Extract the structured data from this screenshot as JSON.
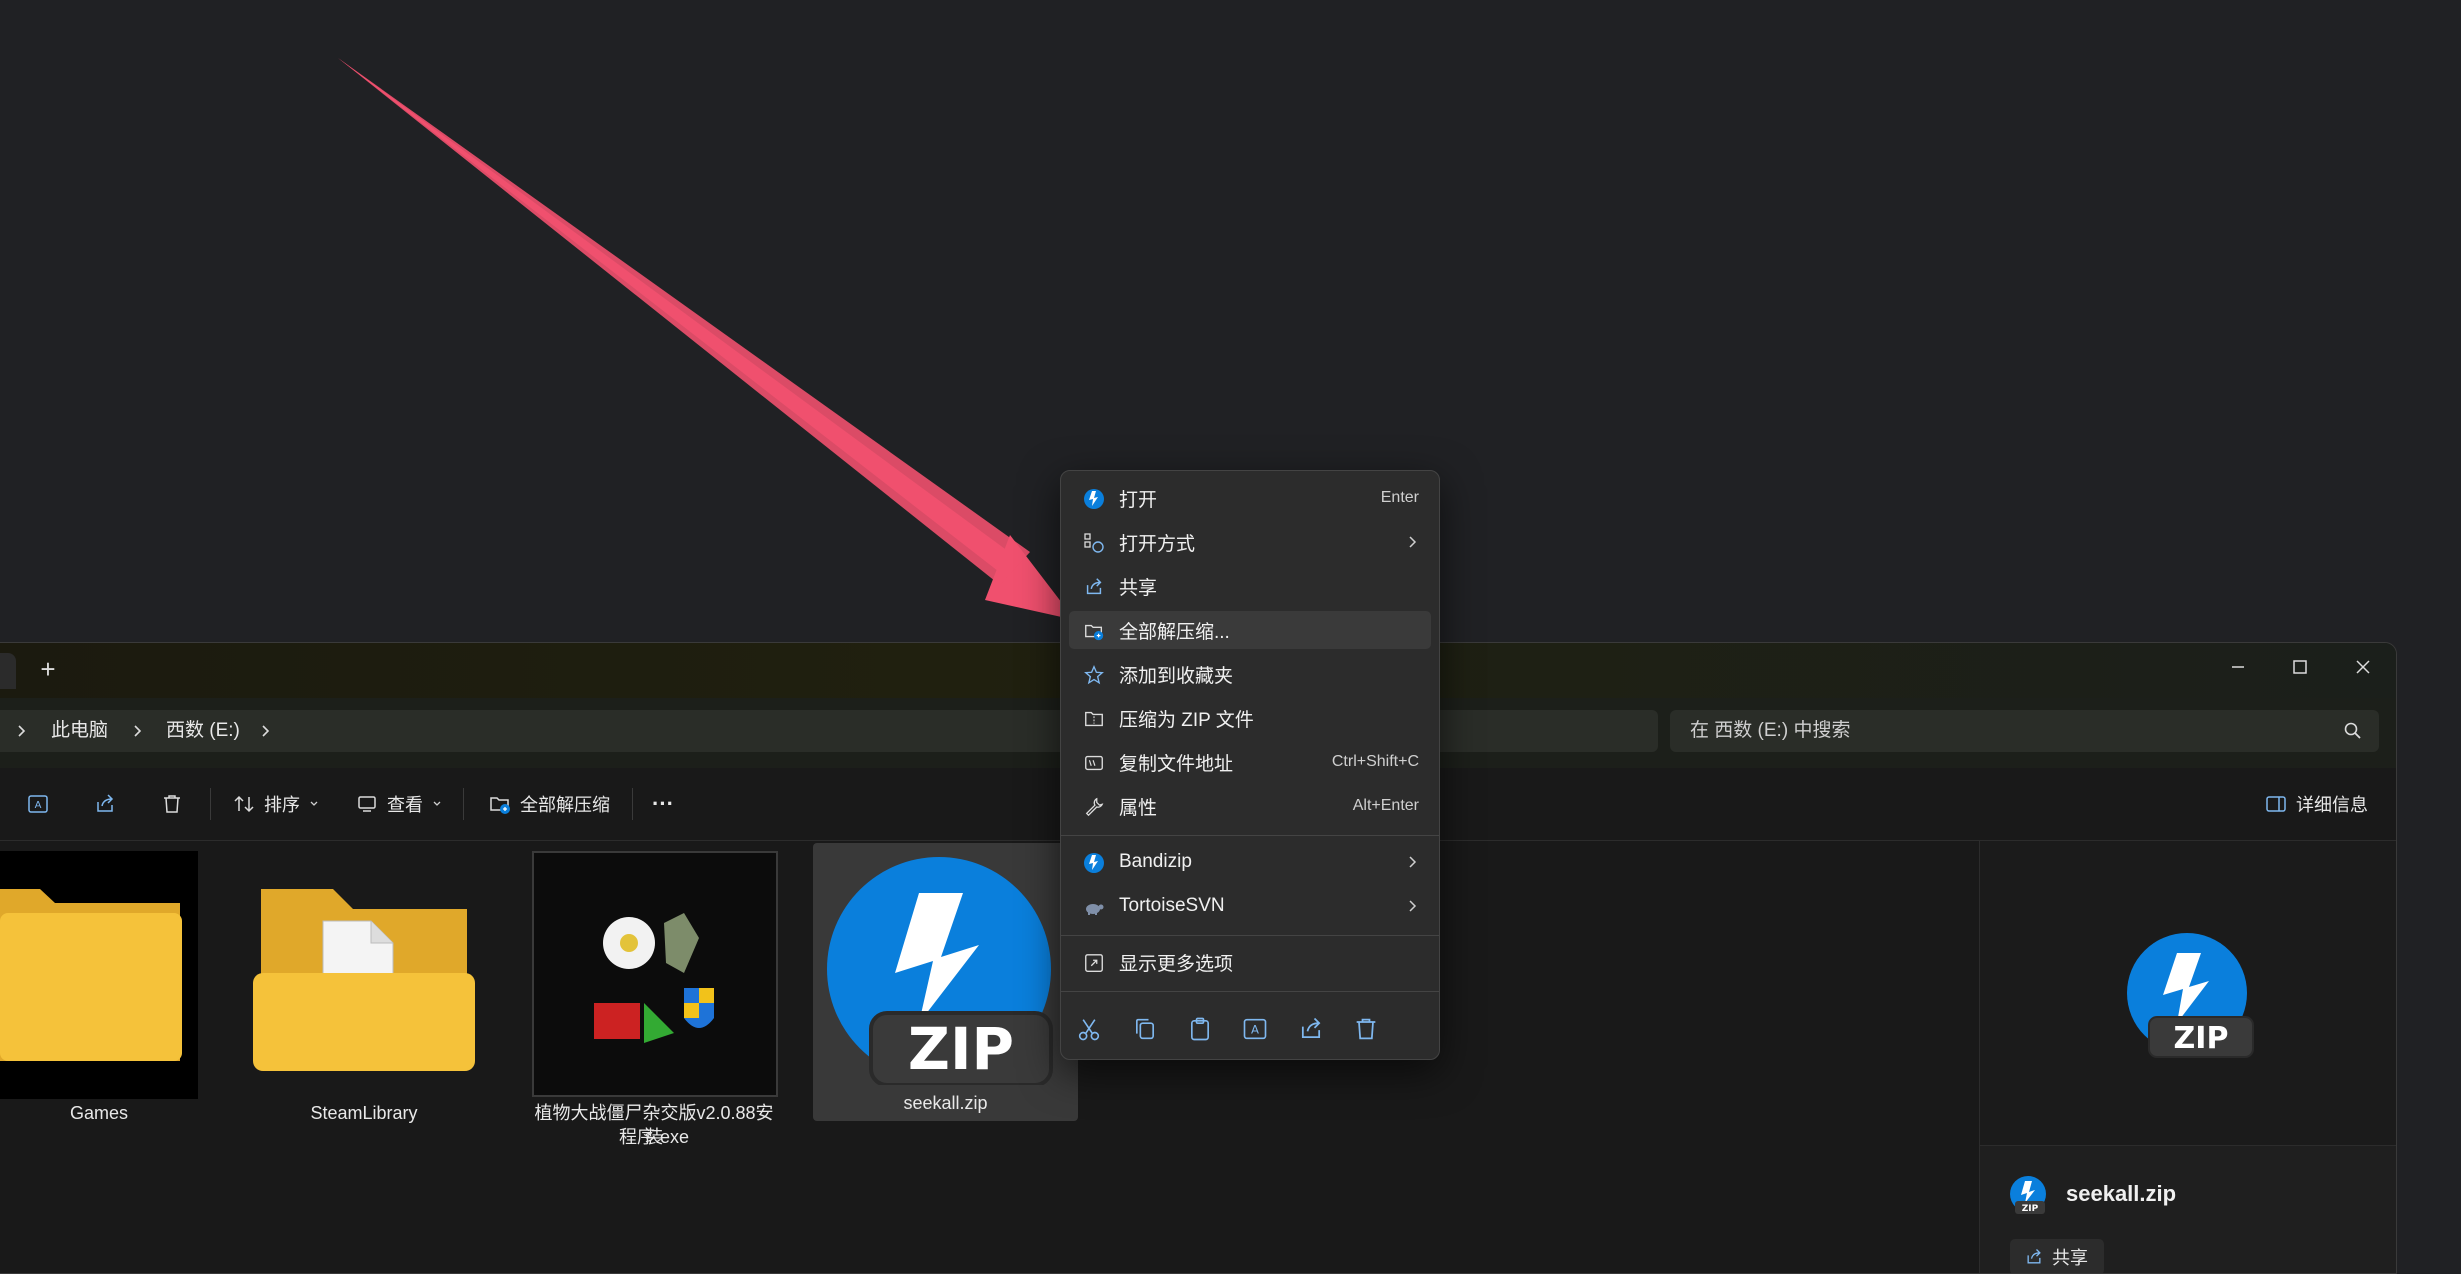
{
  "explorer": {
    "new_tab_symbol": "+",
    "breadcrumb": [
      "此电脑",
      "西数 (E:)"
    ],
    "search_placeholder": "在 西数 (E:) 中搜索",
    "toolbar": {
      "sort_label": "排序",
      "view_label": "查看",
      "extract_all_label": "全部解压缩",
      "more_label": "···",
      "details_label": "详细信息"
    },
    "items": [
      {
        "name": "Games"
      },
      {
        "name": "SteamLibrary"
      },
      {
        "name": "植物大战僵尸杂交版v2.0.88安装",
        "name_line2": "程序.exe"
      },
      {
        "name": "seekall.zip"
      }
    ],
    "preview": {
      "file_name": "seekall.zip",
      "share_label": "共享",
      "zip_badge": "ZIP"
    }
  },
  "context_menu": {
    "items": [
      {
        "label": "打开",
        "shortcut": "Enter",
        "icon": "bandizip-icon"
      },
      {
        "label": "打开方式",
        "icon": "open-with-icon",
        "submenu": true
      },
      {
        "label": "共享",
        "icon": "share-icon"
      },
      {
        "label": "全部解压缩...",
        "icon": "extract-folder-icon",
        "highlighted": true
      },
      {
        "label": "添加到收藏夹",
        "icon": "star-icon"
      },
      {
        "label": "压缩为 ZIP 文件",
        "icon": "zip-folder-icon"
      },
      {
        "label": "复制文件地址",
        "shortcut": "Ctrl+Shift+C",
        "icon": "copy-path-icon"
      },
      {
        "label": "属性",
        "shortcut": "Alt+Enter",
        "icon": "wrench-icon"
      },
      {
        "label": "Bandizip",
        "icon": "bandizip-icon",
        "submenu": true
      },
      {
        "label": "TortoiseSVN",
        "icon": "tortoise-icon",
        "submenu": true
      },
      {
        "label": "显示更多选项",
        "icon": "more-options-icon"
      }
    ],
    "bottom_actions": [
      "cut-icon",
      "copy-icon",
      "paste-icon",
      "rename-icon",
      "share-icon",
      "delete-icon"
    ]
  },
  "colors": {
    "annotation_arrow": "#f0506e",
    "accent": "#0a7fdc",
    "folder": "#f5c23a"
  }
}
